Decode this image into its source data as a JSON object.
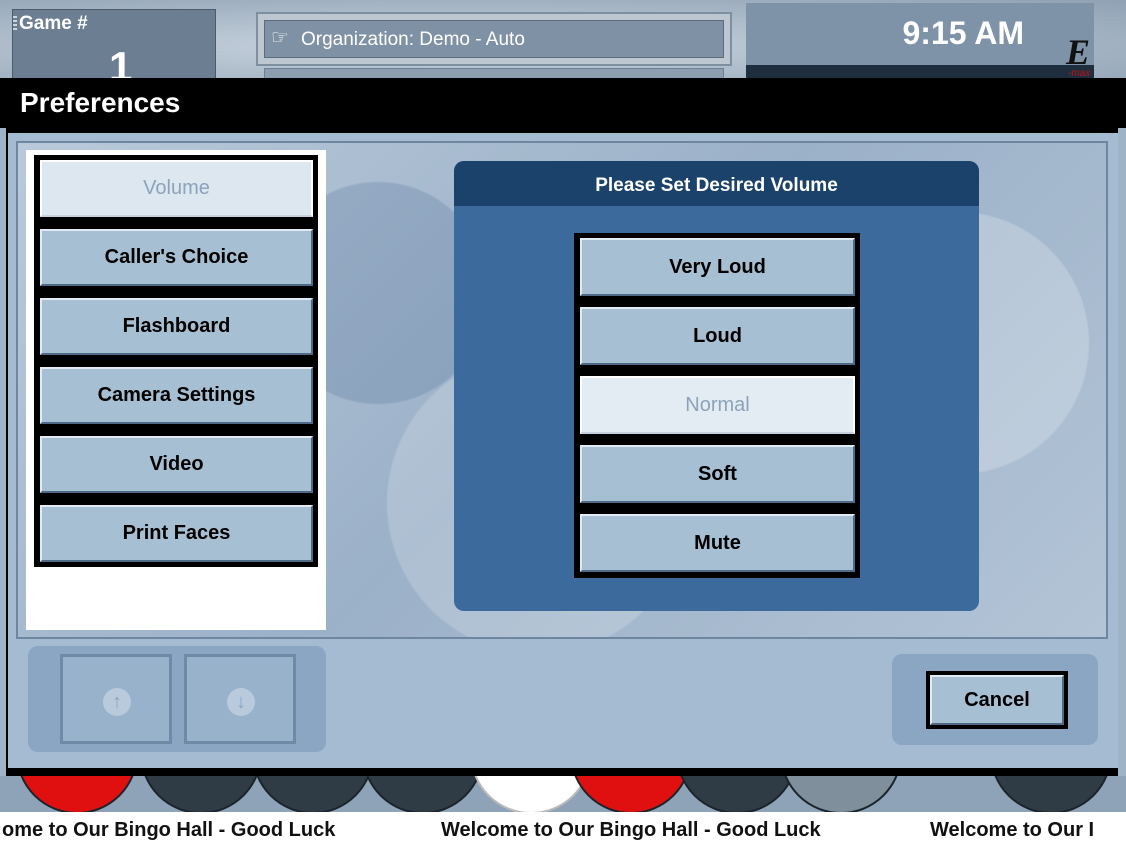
{
  "header": {
    "game_label": "Game #",
    "game_number": "1",
    "organization": "Organization: Demo - Auto",
    "time": "9:15 AM",
    "logo": "E-max logo"
  },
  "page_title": "Preferences",
  "nav": {
    "items": [
      {
        "label": "Volume",
        "selected": true
      },
      {
        "label": "Caller's Choice",
        "selected": false
      },
      {
        "label": "Flashboard",
        "selected": false
      },
      {
        "label": "Camera Settings",
        "selected": false
      },
      {
        "label": "Video",
        "selected": false
      },
      {
        "label": "Print Faces",
        "selected": false
      }
    ]
  },
  "volume": {
    "heading": "Please Set Desired Volume",
    "options": [
      {
        "label": "Very Loud",
        "selected": false
      },
      {
        "label": "Loud",
        "selected": false
      },
      {
        "label": "Normal",
        "selected": true
      },
      {
        "label": "Soft",
        "selected": false
      },
      {
        "label": "Mute",
        "selected": false
      }
    ]
  },
  "scroll": {
    "up_icon": "arrow-up-circle-icon",
    "down_icon": "arrow-down-circle-icon"
  },
  "cancel_label": "Cancel",
  "ticker": {
    "segments": [
      "ome to Our Bingo Hall - Good Luck",
      "Welcome to Our Bingo Hall - Good Luck",
      "Welcome to Our I"
    ]
  },
  "colors": {
    "panel_bg": "#a5bbd2",
    "dialog_header": "#1b426b",
    "dialog_body": "#3c6a9c",
    "button_face": "#a7bfd2",
    "selected_button": "#dde7f0"
  }
}
